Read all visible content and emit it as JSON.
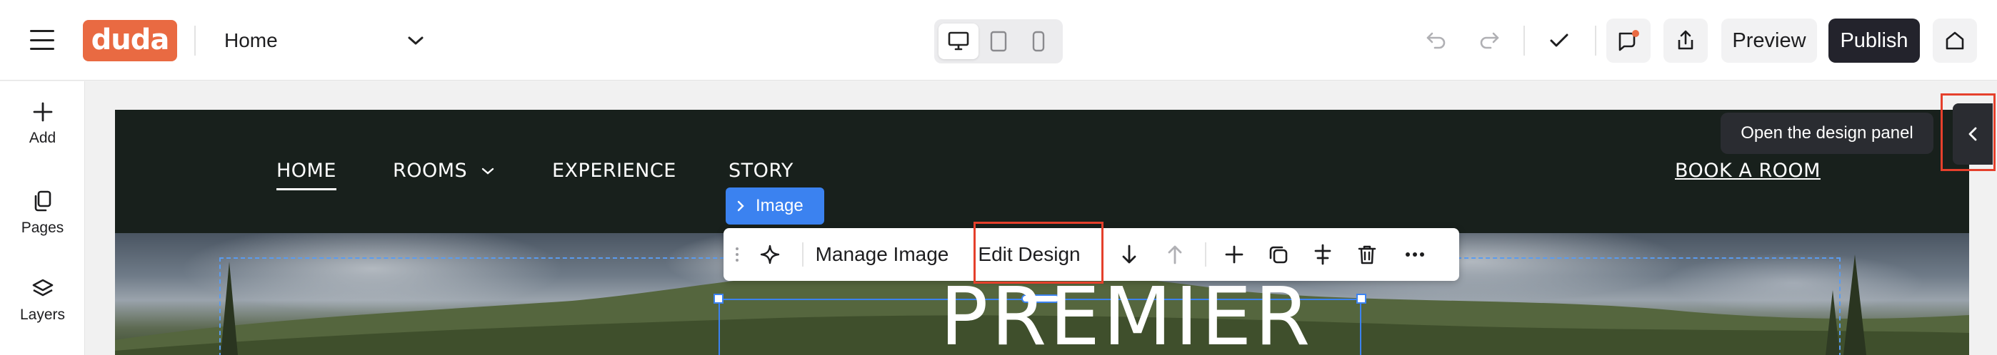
{
  "topbar": {
    "logo_text": "duda",
    "page_selector": "Home",
    "preview_label": "Preview",
    "publish_label": "Publish",
    "icons": [
      "hamburger-icon",
      "chevron-down-icon",
      "desktop-icon",
      "tablet-icon",
      "mobile-icon",
      "undo-icon",
      "redo-icon",
      "check-icon",
      "comments-icon",
      "share-icon",
      "home-icon"
    ]
  },
  "sidebar": {
    "items": [
      {
        "label": "Add",
        "icon": "plus-icon"
      },
      {
        "label": "Pages",
        "icon": "pages-icon"
      },
      {
        "label": "Layers",
        "icon": "layers-icon"
      }
    ]
  },
  "site": {
    "nav": {
      "home": "HOME",
      "rooms": "ROOMS",
      "experience": "EXPERIENCE",
      "story": "STORY",
      "book": "BOOK A ROOM"
    },
    "hero_title": "PREMIER"
  },
  "editor": {
    "element_label": "Image",
    "toolbar": {
      "manage_image": "Manage Image",
      "edit_design": "Edit Design",
      "icons": [
        "drag-handle-icon",
        "sparkle-icon",
        "move-down-icon",
        "move-up-icon",
        "add-icon",
        "duplicate-icon",
        "align-icon",
        "delete-icon",
        "more-icon"
      ]
    },
    "design_panel_tooltip": "Open the design panel"
  },
  "colors": {
    "brand": "#e96a42",
    "publish": "#23232c",
    "selection": "#3b82f0",
    "highlight": "#e5402c",
    "canvas_header": "#18201c"
  }
}
